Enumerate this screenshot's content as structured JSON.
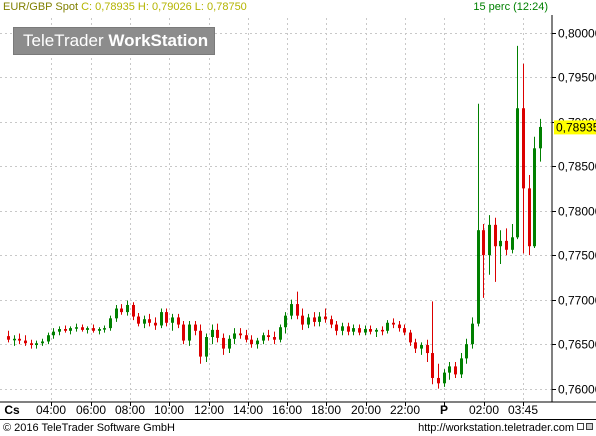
{
  "header": {
    "symbol": "EUR/GBP Spot",
    "ohlc": "C: 0,78935 H: 0,79026 L: 0,78750",
    "period": "15 perc (12:24)"
  },
  "logo": {
    "part1": "TeleTrader ",
    "part2": "WorkStation"
  },
  "footer": {
    "copyright": "© 2016 TeleTrader Software GmbH",
    "url": "http://workstation.teletrader.com"
  },
  "colors": {
    "up": "#008000",
    "down": "#dc0000",
    "last_price_bg": "#ffff00",
    "grid": "#c8c8c8"
  },
  "chart_data": {
    "type": "candlestick",
    "ylim": [
      0.7585,
      0.8022
    ],
    "y_ticks": [
      {
        "value": 0.8,
        "label": "0,80000"
      },
      {
        "value": 0.795,
        "label": "0,79500"
      },
      {
        "value": 0.79,
        "label": "0,79000"
      },
      {
        "value": 0.785,
        "label": "0,78500"
      },
      {
        "value": 0.78,
        "label": "0,78000"
      },
      {
        "value": 0.775,
        "label": "0,77500"
      },
      {
        "value": 0.77,
        "label": "0,77000"
      },
      {
        "value": 0.765,
        "label": "0,76500"
      },
      {
        "value": 0.76,
        "label": "0,76000"
      }
    ],
    "last_price": {
      "value": 0.78935,
      "label": "0,78935"
    },
    "x_labels": [
      "Cs",
      "04:00",
      "06:00",
      "08:00",
      "10:00",
      "12:00",
      "14:00",
      "16:00",
      "18:00",
      "20:00",
      "22:00",
      "P",
      "02:00",
      "03:45"
    ],
    "candles": [
      {
        "o": 0.7659,
        "h": 0.7665,
        "l": 0.7652,
        "c": 0.7655
      },
      {
        "o": 0.7655,
        "h": 0.766,
        "l": 0.7648,
        "c": 0.7656
      },
      {
        "o": 0.7656,
        "h": 0.7662,
        "l": 0.765,
        "c": 0.7654
      },
      {
        "o": 0.7654,
        "h": 0.766,
        "l": 0.7648,
        "c": 0.7651
      },
      {
        "o": 0.7651,
        "h": 0.7655,
        "l": 0.7645,
        "c": 0.7649
      },
      {
        "o": 0.7649,
        "h": 0.7654,
        "l": 0.7645,
        "c": 0.7651
      },
      {
        "o": 0.7651,
        "h": 0.7656,
        "l": 0.7648,
        "c": 0.7653
      },
      {
        "o": 0.7653,
        "h": 0.7663,
        "l": 0.765,
        "c": 0.766
      },
      {
        "o": 0.766,
        "h": 0.7668,
        "l": 0.7656,
        "c": 0.7664
      },
      {
        "o": 0.7664,
        "h": 0.767,
        "l": 0.766,
        "c": 0.7667
      },
      {
        "o": 0.7667,
        "h": 0.7671,
        "l": 0.7663,
        "c": 0.7665
      },
      {
        "o": 0.7665,
        "h": 0.767,
        "l": 0.7661,
        "c": 0.7668
      },
      {
        "o": 0.7668,
        "h": 0.7673,
        "l": 0.7664,
        "c": 0.7669
      },
      {
        "o": 0.7669,
        "h": 0.7672,
        "l": 0.7664,
        "c": 0.7666
      },
      {
        "o": 0.7666,
        "h": 0.767,
        "l": 0.7662,
        "c": 0.7668
      },
      {
        "o": 0.7668,
        "h": 0.7672,
        "l": 0.7663,
        "c": 0.7665
      },
      {
        "o": 0.7665,
        "h": 0.7669,
        "l": 0.7661,
        "c": 0.7667
      },
      {
        "o": 0.7667,
        "h": 0.7671,
        "l": 0.7663,
        "c": 0.7668
      },
      {
        "o": 0.7668,
        "h": 0.7682,
        "l": 0.7665,
        "c": 0.7679
      },
      {
        "o": 0.7679,
        "h": 0.7694,
        "l": 0.7675,
        "c": 0.769
      },
      {
        "o": 0.769,
        "h": 0.7695,
        "l": 0.7683,
        "c": 0.7686
      },
      {
        "o": 0.7686,
        "h": 0.7699,
        "l": 0.7682,
        "c": 0.7694
      },
      {
        "o": 0.7694,
        "h": 0.7697,
        "l": 0.7677,
        "c": 0.7681
      },
      {
        "o": 0.7681,
        "h": 0.7685,
        "l": 0.767,
        "c": 0.7673
      },
      {
        "o": 0.7673,
        "h": 0.7682,
        "l": 0.7668,
        "c": 0.7678
      },
      {
        "o": 0.7678,
        "h": 0.7684,
        "l": 0.767,
        "c": 0.7674
      },
      {
        "o": 0.7674,
        "h": 0.768,
        "l": 0.7666,
        "c": 0.7671
      },
      {
        "o": 0.7671,
        "h": 0.769,
        "l": 0.7668,
        "c": 0.7686
      },
      {
        "o": 0.7686,
        "h": 0.769,
        "l": 0.767,
        "c": 0.7674
      },
      {
        "o": 0.7674,
        "h": 0.7684,
        "l": 0.7665,
        "c": 0.768
      },
      {
        "o": 0.768,
        "h": 0.7684,
        "l": 0.7668,
        "c": 0.7672
      },
      {
        "o": 0.7672,
        "h": 0.7676,
        "l": 0.765,
        "c": 0.7654
      },
      {
        "o": 0.7654,
        "h": 0.7676,
        "l": 0.7648,
        "c": 0.7672
      },
      {
        "o": 0.7672,
        "h": 0.7676,
        "l": 0.766,
        "c": 0.7665
      },
      {
        "o": 0.7665,
        "h": 0.7672,
        "l": 0.7628,
        "c": 0.7636
      },
      {
        "o": 0.7636,
        "h": 0.7662,
        "l": 0.763,
        "c": 0.7658
      },
      {
        "o": 0.7658,
        "h": 0.7672,
        "l": 0.765,
        "c": 0.7666
      },
      {
        "o": 0.7666,
        "h": 0.7673,
        "l": 0.7652,
        "c": 0.7657
      },
      {
        "o": 0.7657,
        "h": 0.7662,
        "l": 0.7638,
        "c": 0.7645
      },
      {
        "o": 0.7645,
        "h": 0.766,
        "l": 0.764,
        "c": 0.7656
      },
      {
        "o": 0.7656,
        "h": 0.7668,
        "l": 0.765,
        "c": 0.7662
      },
      {
        "o": 0.7662,
        "h": 0.7668,
        "l": 0.7656,
        "c": 0.766
      },
      {
        "o": 0.766,
        "h": 0.7666,
        "l": 0.7652,
        "c": 0.7655
      },
      {
        "o": 0.7655,
        "h": 0.766,
        "l": 0.7646,
        "c": 0.765
      },
      {
        "o": 0.765,
        "h": 0.7657,
        "l": 0.7645,
        "c": 0.7654
      },
      {
        "o": 0.7654,
        "h": 0.7663,
        "l": 0.765,
        "c": 0.766
      },
      {
        "o": 0.766,
        "h": 0.7666,
        "l": 0.7654,
        "c": 0.7658
      },
      {
        "o": 0.7658,
        "h": 0.7664,
        "l": 0.765,
        "c": 0.7655
      },
      {
        "o": 0.7655,
        "h": 0.7672,
        "l": 0.7652,
        "c": 0.7669
      },
      {
        "o": 0.7669,
        "h": 0.7686,
        "l": 0.7662,
        "c": 0.7682
      },
      {
        "o": 0.7682,
        "h": 0.77,
        "l": 0.7678,
        "c": 0.7695
      },
      {
        "o": 0.7695,
        "h": 0.7709,
        "l": 0.7678,
        "c": 0.7682
      },
      {
        "o": 0.7682,
        "h": 0.769,
        "l": 0.7666,
        "c": 0.7672
      },
      {
        "o": 0.7672,
        "h": 0.7684,
        "l": 0.7668,
        "c": 0.768
      },
      {
        "o": 0.768,
        "h": 0.7686,
        "l": 0.767,
        "c": 0.7675
      },
      {
        "o": 0.7675,
        "h": 0.7686,
        "l": 0.767,
        "c": 0.7681
      },
      {
        "o": 0.7681,
        "h": 0.769,
        "l": 0.7674,
        "c": 0.7678
      },
      {
        "o": 0.7678,
        "h": 0.7682,
        "l": 0.7668,
        "c": 0.7672
      },
      {
        "o": 0.7672,
        "h": 0.7676,
        "l": 0.766,
        "c": 0.7665
      },
      {
        "o": 0.7665,
        "h": 0.7674,
        "l": 0.766,
        "c": 0.767
      },
      {
        "o": 0.767,
        "h": 0.7674,
        "l": 0.766,
        "c": 0.7664
      },
      {
        "o": 0.7664,
        "h": 0.7672,
        "l": 0.766,
        "c": 0.7668
      },
      {
        "o": 0.7668,
        "h": 0.7672,
        "l": 0.766,
        "c": 0.7663
      },
      {
        "o": 0.7663,
        "h": 0.7671,
        "l": 0.766,
        "c": 0.7667
      },
      {
        "o": 0.7667,
        "h": 0.7671,
        "l": 0.7661,
        "c": 0.7664
      },
      {
        "o": 0.7664,
        "h": 0.7668,
        "l": 0.7658,
        "c": 0.7666
      },
      {
        "o": 0.7666,
        "h": 0.767,
        "l": 0.766,
        "c": 0.7665
      },
      {
        "o": 0.7665,
        "h": 0.7677,
        "l": 0.7662,
        "c": 0.7674
      },
      {
        "o": 0.7674,
        "h": 0.7679,
        "l": 0.7668,
        "c": 0.7672
      },
      {
        "o": 0.7672,
        "h": 0.7676,
        "l": 0.7664,
        "c": 0.7668
      },
      {
        "o": 0.7668,
        "h": 0.7672,
        "l": 0.766,
        "c": 0.7663
      },
      {
        "o": 0.7663,
        "h": 0.7666,
        "l": 0.7648,
        "c": 0.7652
      },
      {
        "o": 0.7652,
        "h": 0.7656,
        "l": 0.764,
        "c": 0.7645
      },
      {
        "o": 0.7645,
        "h": 0.7652,
        "l": 0.7638,
        "c": 0.7649
      },
      {
        "o": 0.7649,
        "h": 0.7655,
        "l": 0.763,
        "c": 0.764
      },
      {
        "o": 0.764,
        "h": 0.7698,
        "l": 0.7605,
        "c": 0.7612
      },
      {
        "o": 0.7612,
        "h": 0.7628,
        "l": 0.76,
        "c": 0.7606
      },
      {
        "o": 0.7606,
        "h": 0.7622,
        "l": 0.7602,
        "c": 0.7618
      },
      {
        "o": 0.7618,
        "h": 0.763,
        "l": 0.761,
        "c": 0.7625
      },
      {
        "o": 0.7625,
        "h": 0.763,
        "l": 0.7612,
        "c": 0.7616
      },
      {
        "o": 0.7616,
        "h": 0.764,
        "l": 0.7612,
        "c": 0.7634
      },
      {
        "o": 0.7634,
        "h": 0.7656,
        "l": 0.7628,
        "c": 0.765
      },
      {
        "o": 0.765,
        "h": 0.768,
        "l": 0.7645,
        "c": 0.7673
      },
      {
        "o": 0.7673,
        "h": 0.792,
        "l": 0.767,
        "c": 0.7778
      },
      {
        "o": 0.7778,
        "h": 0.7785,
        "l": 0.7702,
        "c": 0.775
      },
      {
        "o": 0.775,
        "h": 0.7795,
        "l": 0.7728,
        "c": 0.7784
      },
      {
        "o": 0.7784,
        "h": 0.7792,
        "l": 0.772,
        "c": 0.776
      },
      {
        "o": 0.776,
        "h": 0.7778,
        "l": 0.774,
        "c": 0.7766
      },
      {
        "o": 0.7766,
        "h": 0.778,
        "l": 0.775,
        "c": 0.7756
      },
      {
        "o": 0.7756,
        "h": 0.7785,
        "l": 0.7752,
        "c": 0.777
      },
      {
        "o": 0.777,
        "h": 0.7985,
        "l": 0.7768,
        "c": 0.7915
      },
      {
        "o": 0.7915,
        "h": 0.7965,
        "l": 0.7752,
        "c": 0.7825
      },
      {
        "o": 0.7825,
        "h": 0.784,
        "l": 0.775,
        "c": 0.776
      },
      {
        "o": 0.776,
        "h": 0.7883,
        "l": 0.7758,
        "c": 0.787
      },
      {
        "o": 0.787,
        "h": 0.7903,
        "l": 0.7855,
        "c": 0.7894
      }
    ]
  }
}
